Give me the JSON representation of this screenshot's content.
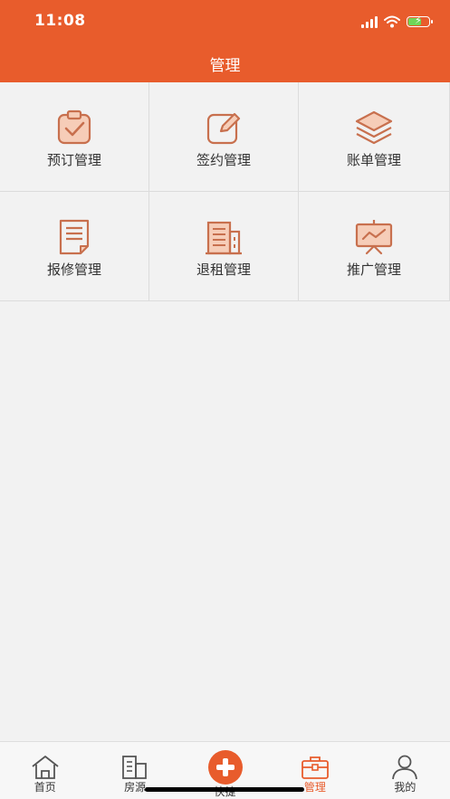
{
  "status_bar": {
    "time": "11:08"
  },
  "header": {
    "title": "管理"
  },
  "grid": [
    {
      "label": "预订管理",
      "icon": "clipboard-check-icon"
    },
    {
      "label": "签约管理",
      "icon": "pen-edit-icon"
    },
    {
      "label": "账单管理",
      "icon": "layers-icon"
    },
    {
      "label": "报修管理",
      "icon": "document-icon"
    },
    {
      "label": "退租管理",
      "icon": "building-icon"
    },
    {
      "label": "推广管理",
      "icon": "presentation-board-icon"
    }
  ],
  "tabbar": [
    {
      "label": "首页",
      "icon": "home-icon"
    },
    {
      "label": "房源",
      "icon": "building-icon"
    },
    {
      "label": "快捷",
      "icon": "plus-icon"
    },
    {
      "label": "管理",
      "icon": "briefcase-icon",
      "active": true
    },
    {
      "label": "我的",
      "icon": "user-icon"
    }
  ],
  "colors": {
    "accent": "#e85c2c",
    "icon_stroke": "#c8704e",
    "icon_fill": "#f6cdb8"
  }
}
